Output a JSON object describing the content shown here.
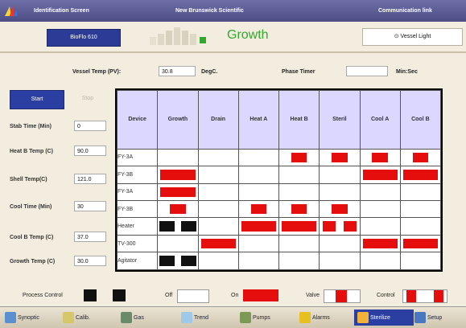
{
  "titlebar": {
    "left": "Identification Screen",
    "center": "New Brunswick Scientific",
    "right": "Communication link"
  },
  "header": {
    "batch": "BioFlo 610",
    "phase": "Growth",
    "vessel_light": "Vessel Light"
  },
  "vessel": {
    "temp_label": "Vessel Temp (PV):",
    "temp_value": "30.8",
    "temp_unit": "DegC.",
    "timer_label": "Phase Timer",
    "timer_value": "",
    "timer_unit": "Min:Sec"
  },
  "controls": {
    "start": "Start",
    "stop": "Stop"
  },
  "params": [
    {
      "label": "Stab Time (Min)",
      "value": "0"
    },
    {
      "label": "Heat B Temp (C)",
      "value": "90.0"
    },
    {
      "label": "Shell Temp(C)",
      "value": "121.0"
    },
    {
      "label": "Cool Time (Min)",
      "value": "30"
    },
    {
      "label": "Cool B Temp (C)",
      "value": "37.0"
    },
    {
      "label": "Growth Temp (C)",
      "value": "30.0"
    }
  ],
  "grid": {
    "columns": [
      "Device",
      "Growth",
      "Drain",
      "Heat A",
      "Heat B",
      "Steril",
      "Cool A",
      "Cool B"
    ],
    "rows": [
      {
        "device": "FY-3A",
        "cells": [
          "",
          "",
          "",
          "r",
          "r",
          "r",
          "r"
        ]
      },
      {
        "device": "FY-3B",
        "cells": [
          "R",
          "",
          "",
          "",
          "",
          "R",
          "R"
        ]
      },
      {
        "device": "FY-3A",
        "cells": [
          "R",
          "",
          "",
          "",
          "",
          "",
          ""
        ]
      },
      {
        "device": "FY-3B",
        "cells": [
          "r",
          "",
          "r",
          "r",
          "r",
          "",
          ""
        ]
      },
      {
        "device": "Heater",
        "cells": [
          "B",
          "",
          "R",
          "R",
          "rr",
          "",
          ""
        ]
      },
      {
        "device": "TV-300",
        "cells": [
          "",
          "R",
          "",
          "",
          "",
          "R",
          "R"
        ]
      },
      {
        "device": "Agitator",
        "cells": [
          "B",
          "",
          "",
          "",
          "",
          "",
          ""
        ]
      }
    ]
  },
  "legend": {
    "process": "Process Control",
    "off": "Off",
    "on": "On",
    "valve": "Valve",
    "control": "Control"
  },
  "nav": [
    {
      "label": "Synoptic"
    },
    {
      "label": "Calib."
    },
    {
      "label": "Gas"
    },
    {
      "label": "Trend"
    },
    {
      "label": "Pumps"
    },
    {
      "label": "Alarms"
    },
    {
      "label": "Sterilize"
    },
    {
      "label": "Setup"
    }
  ],
  "colors": {
    "accent": "#2b3fa2",
    "active": "#e60d0d",
    "growth": "#32a82c"
  }
}
